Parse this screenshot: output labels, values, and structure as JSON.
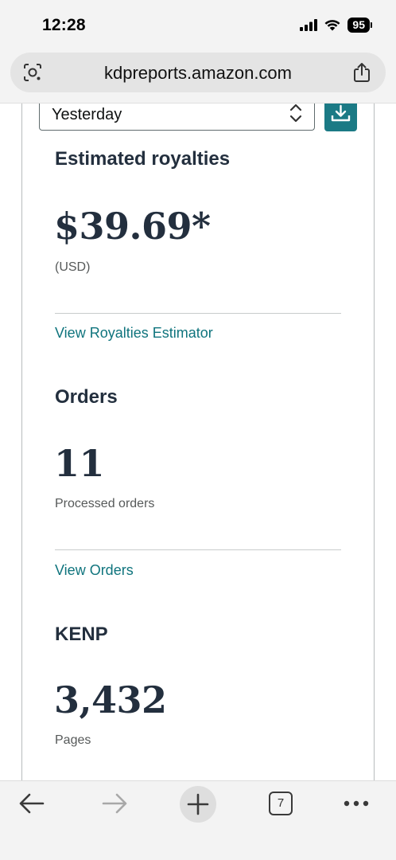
{
  "status_bar": {
    "time": "12:28",
    "battery": "95",
    "icons": [
      "cellular-signal-icon",
      "wifi-icon",
      "battery-icon"
    ]
  },
  "browser": {
    "url": "kdpreports.amazon.com",
    "tab_count": "7",
    "icons": [
      "lens-icon",
      "share-icon",
      "back-arrow-icon",
      "forward-arrow-icon",
      "plus-icon",
      "tabs-icon",
      "more-icon"
    ]
  },
  "filter": {
    "selected": "Yesterday"
  },
  "royalties": {
    "title": "Estimated royalties",
    "value": "$39.69*",
    "currency": "(USD)",
    "link": "View Royalties Estimator"
  },
  "orders": {
    "title": "Orders",
    "value": "11",
    "label": "Processed orders",
    "link": "View Orders"
  },
  "kenp": {
    "title": "KENP",
    "value": "3,432",
    "label": "Pages"
  },
  "colors": {
    "accent": "#1b7a85",
    "link": "#0f747d",
    "heading": "#232f3e"
  }
}
